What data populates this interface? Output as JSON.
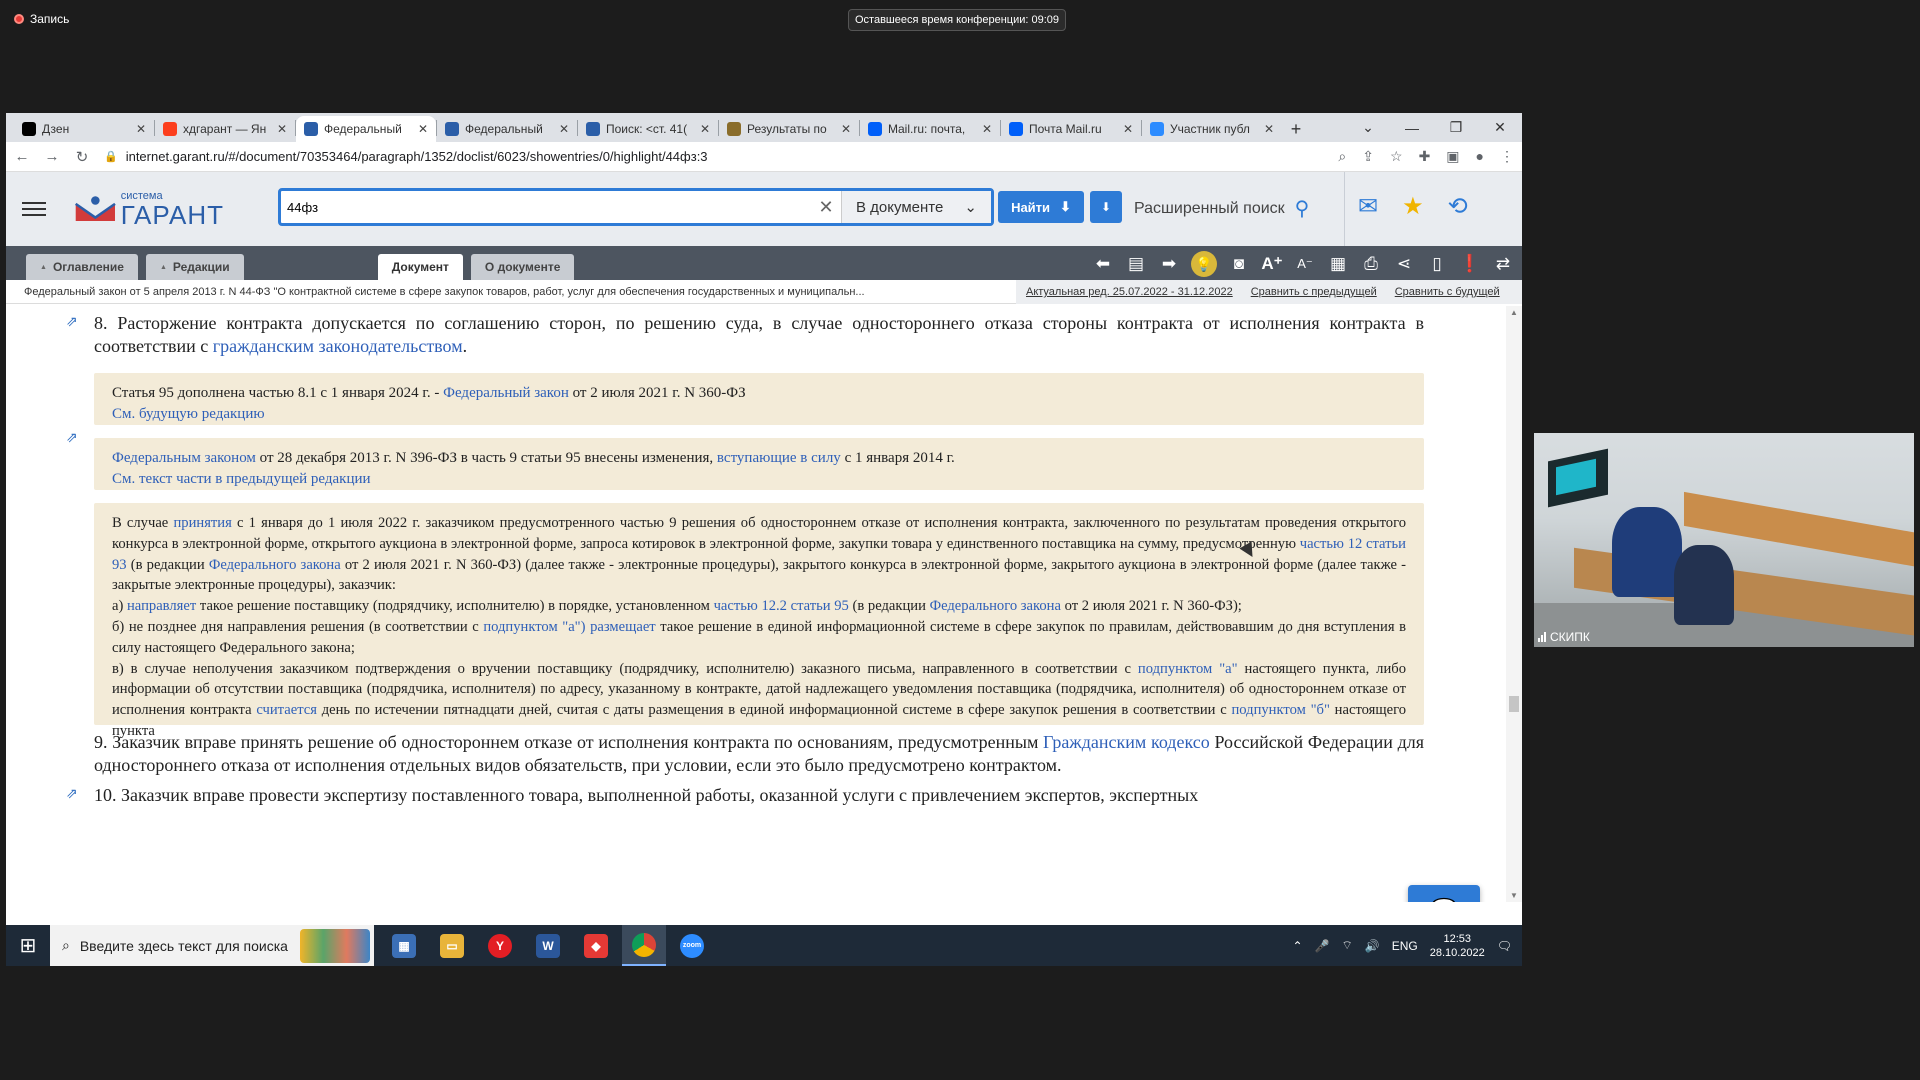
{
  "overlay": {
    "recording_label": "Запись",
    "time_remaining": "Оставшееся время конференции: 09:09"
  },
  "browser": {
    "tabs": [
      {
        "label": "Дзен",
        "icon": "dzen-icon",
        "color": "#000000"
      },
      {
        "label": "хдгарант — Ян",
        "icon": "yandex-icon",
        "color": "#fc3f1d"
      },
      {
        "label": "Федеральный",
        "icon": "garant-icon",
        "color": "#2b5ea8",
        "active": true
      },
      {
        "label": "Федеральный",
        "icon": "garant-icon",
        "color": "#2b5ea8"
      },
      {
        "label": "Поиск: <ст. 41(",
        "icon": "garant-icon",
        "color": "#2b5ea8"
      },
      {
        "label": "Результаты по",
        "icon": "emblem-icon",
        "color": "#8a6d2b"
      },
      {
        "label": "Mail.ru: почта,",
        "icon": "mailru-icon",
        "color": "#005ff9"
      },
      {
        "label": "Почта Mail.ru",
        "icon": "mail-icon",
        "color": "#005ff9"
      },
      {
        "label": "Участник публ",
        "icon": "zoom-icon",
        "color": "#2d8cff"
      }
    ],
    "url": "internet.garant.ru/#/document/70353464/paragraph/1352/doclist/6023/showentries/0/highlight/44фз:3"
  },
  "garant": {
    "logo_small": "система",
    "logo_big": "ГАРАНТ",
    "search_value": "44фз",
    "search_scope": "В документе",
    "find_label": "Найти",
    "advanced_search": "Расширенный поиск",
    "tabs": {
      "contents": "Оглавление",
      "editions": "Редакции",
      "document": "Документ",
      "about": "О документе"
    },
    "doc_title": "Федеральный закон от 5 апреля 2013 г. N 44-ФЗ \"О контрактной системе в сфере закупок товаров, работ, услуг для обеспечения государственных и муниципальн...",
    "edition": "Актуальная ред. 25.07.2022 - 31.12.2022",
    "compare_prev": "Сравнить с предыдущей",
    "compare_next": "Сравнить с будущей"
  },
  "document": {
    "p8_a": "8. Расторжение контракта допускается по соглашению сторон, по решению суда, в случае одностороннего отказа стороны контракта от исполнения контракта в соответствии с ",
    "p8_link": "гражданским законодательством",
    "p8_b": ".",
    "note1_a": "Статья 95 дополнена частью 8.1 с 1 января 2024 г. - ",
    "note1_link": "Федеральный закон",
    "note1_b": " от 2 июля 2021 г. N 360-ФЗ",
    "note1_link2": "См. будущую редакцию",
    "note2_link": "Федеральным законом",
    "note2_a": " от 28 декабря 2013 г. N 396-ФЗ в часть 9 статьи 95 внесены изменения, ",
    "note2_link2": "вступающие в силу",
    "note2_b": " с 1 января 2014 г.",
    "note2_link3": "См. текст части в предыдущей редакции",
    "n3": {
      "t1": "В случае ",
      "l1": "принятия",
      "t2": " с 1 января до 1 июля 2022 г. заказчиком предусмотренного частью 9 решения об одностороннем отказе от исполнения контракта, заключенного по результатам проведения открытого конкурса в электронной форме, открытого аукциона в электронной форме, запроса котировок в электронной форме, закупки товара у единственного поставщика на сумму, предусмотренную ",
      "l2": "частью 12 статьи 93",
      "t3": " (в редакции ",
      "l3": "Федерального закона",
      "t4": " от 2 июля 2021 г. N 360-ФЗ) (далее также - электронные процедуры), закрытого конкурса в электронной форме, закрытого аукциона в электронной форме (далее также - закрытые электронные процедуры), заказчик:",
      "a1": "а) ",
      "al1": "направляет",
      "a2": " такое решение поставщику (подрядчику, исполнителю) в порядке, установленном ",
      "al2": "частью 12.2 статьи 95",
      "a3": " (в редакции ",
      "al3": "Федерального закона",
      "a4": " от 2 июля 2021 г. N 360-ФЗ);",
      "b1": "б) не позднее дня направления решения (в соответствии с ",
      "bl1": "подпунктом \"а\")",
      "b2": " ",
      "bl2": "размещает",
      "b3": " такое решение в единой информационной системе в сфере закупок по правилам, действовавшим до дня вступления в силу настоящего Федерального закона;",
      "v1": "в) в случае неполучения заказчиком подтверждения о вручении поставщику (подрядчику, исполнителю) заказного письма, направленного в соответствии с ",
      "vl1": "подпунктом \"а\"",
      "v2": " настоящего пункта, либо информации об отсутствии поставщика (подрядчика, исполнителя) по адресу, указанному в контракте, датой надлежащего уведомления поставщика (подрядчика, исполнителя) об одностороннем отказе от исполнения контракта ",
      "vl2": "считается",
      "v3": " день по истечении пятнадцати дней, считая с даты размещения в единой информационной системе в сфере закупок решения в соответствии с ",
      "vl3": "подпунктом \"б\"",
      "v4": " настоящего пункта"
    },
    "p9_a": "9. Заказчик вправе принять решение об одностороннем отказе от исполнения контракта по основаниям, предусмотренным ",
    "p9_link": "Гражданским кодексо",
    "p9_b": " Российской Федерации для одностороннего отказа от исполнения отдельных видов обязательств, при условии, если это было предусмотрено контрактом.",
    "p10": "10. Заказчик вправе провести экспертизу поставленного товара, выполненной работы, оказанной услуги с привлечением экспертов, экспертных"
  },
  "taskbar": {
    "search_placeholder": "Введите здесь текст для поиска",
    "lang": "ENG",
    "time": "12:53",
    "date": "28.10.2022"
  },
  "webcam": {
    "participant": "СКИПК"
  }
}
